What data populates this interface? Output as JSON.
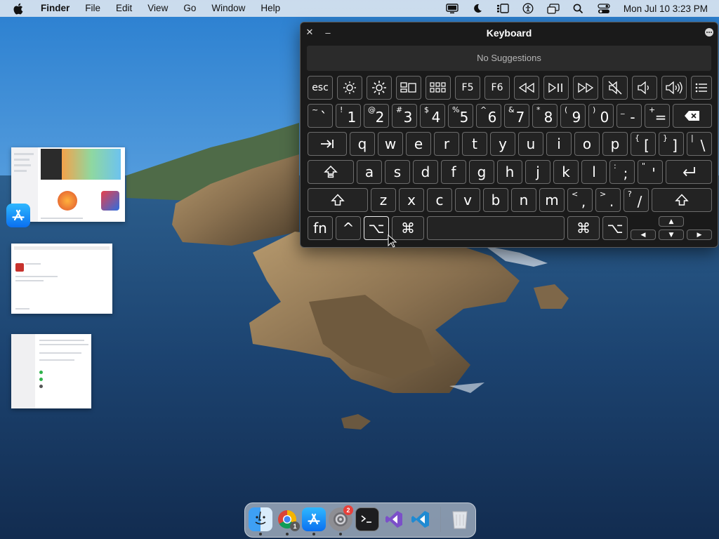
{
  "menubar": {
    "app_name": "Finder",
    "items": [
      "File",
      "Edit",
      "View",
      "Go",
      "Window",
      "Help"
    ],
    "clock": "Mon Jul 10  3:23 PM",
    "status_icons": [
      "display-icon",
      "moon-icon",
      "stage-manager-icon",
      "accessibility-icon",
      "screen-mirroring-icon",
      "search-icon",
      "control-center-icon"
    ]
  },
  "keyboard": {
    "title": "Keyboard",
    "suggestions": "No Suggestions",
    "function_row": [
      "esc",
      "brightness-down-icon",
      "brightness-up-icon",
      "mission-control-icon",
      "launchpad-icon",
      "F5",
      "F6",
      "rewind-icon",
      "play-pause-icon",
      "fast-forward-icon",
      "mute-icon",
      "volume-down-icon",
      "volume-up-icon",
      "list-icon"
    ],
    "f5": "F5",
    "f6": "F6",
    "esc": "esc",
    "number_row": [
      {
        "top": "~",
        "main": "`"
      },
      {
        "top": "!",
        "main": "1"
      },
      {
        "top": "@",
        "main": "2"
      },
      {
        "top": "#",
        "main": "3"
      },
      {
        "top": "$",
        "main": "4"
      },
      {
        "top": "%",
        "main": "5"
      },
      {
        "top": "^",
        "main": "6"
      },
      {
        "top": "&",
        "main": "7"
      },
      {
        "top": "*",
        "main": "8"
      },
      {
        "top": "(",
        "main": "9"
      },
      {
        "top": ")",
        "main": "0"
      },
      {
        "top": "_",
        "main": "-"
      },
      {
        "top": "+",
        "main": "="
      }
    ],
    "qwerty_row": [
      "q",
      "w",
      "e",
      "r",
      "t",
      "y",
      "u",
      "i",
      "o",
      "p"
    ],
    "qwerty_extra": [
      {
        "top": "{",
        "main": "["
      },
      {
        "top": "}",
        "main": "]"
      },
      {
        "top": "|",
        "main": "\\"
      }
    ],
    "home_row": [
      "a",
      "s",
      "d",
      "f",
      "g",
      "h",
      "j",
      "k",
      "l"
    ],
    "home_extra": [
      {
        "top": ":",
        "main": ";"
      },
      {
        "top": "\"",
        "main": "'"
      }
    ],
    "bottom_row": [
      "z",
      "x",
      "c",
      "v",
      "b",
      "n",
      "m"
    ],
    "bottom_extra": [
      {
        "top": "<",
        "main": ","
      },
      {
        "top": ">",
        "main": "."
      },
      {
        "top": "?",
        "main": "/"
      }
    ],
    "fn": "fn",
    "control": "^",
    "option": "⌥",
    "command": "⌘"
  },
  "dock": {
    "apps": [
      "finder-icon",
      "chrome-icon",
      "app-store-icon",
      "system-settings-icon",
      "terminal-icon",
      "visual-studio-icon",
      "vscode-icon",
      "trash-icon"
    ],
    "chrome_badge": "1",
    "settings_badge": "2"
  },
  "colors": {
    "menubar_bg": "#e1e8f0",
    "keyboard_bg": "#1a1a1a",
    "key_border": "#6c6c6c",
    "badge_red": "#e8403a"
  }
}
